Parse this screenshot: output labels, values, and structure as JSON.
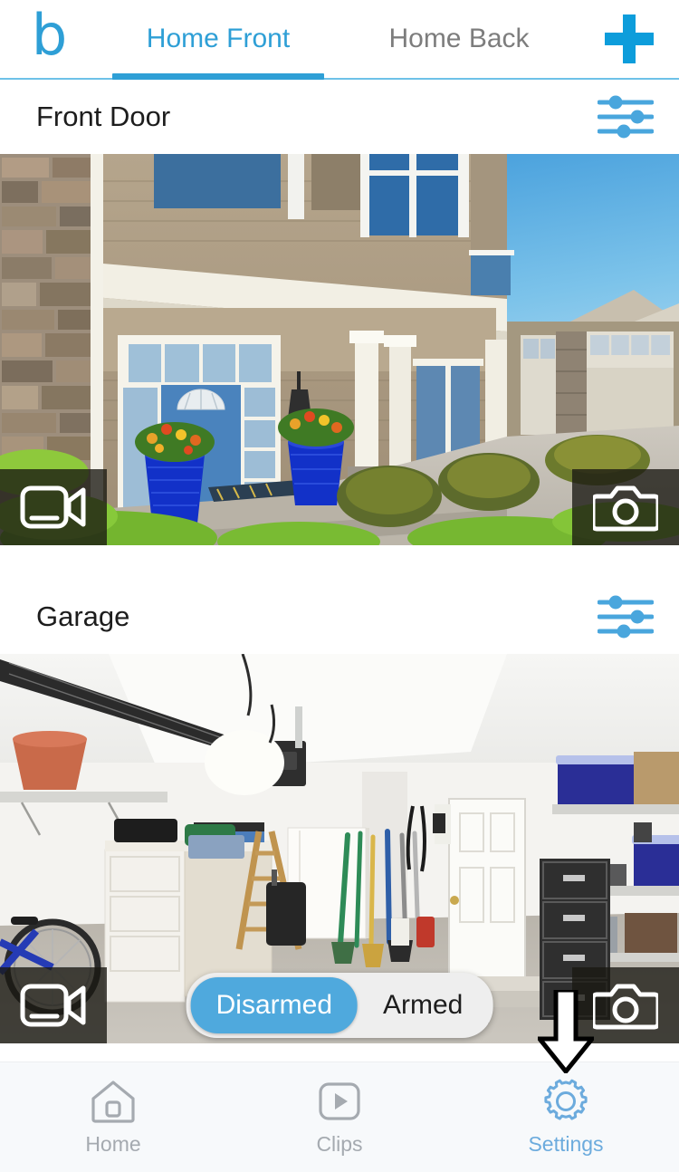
{
  "app": {
    "logo_text": "b",
    "logo_color": "#2e9fd6",
    "accent_color": "#2e9fd6",
    "add_button_label": "+"
  },
  "topbar": {
    "tabs": [
      {
        "label": "Home Front",
        "active": true
      },
      {
        "label": "Home Back",
        "active": false
      }
    ]
  },
  "cameras": [
    {
      "name": "Front Door",
      "settings_icon": "sliders-icon",
      "video_button_icon": "video-camera-icon",
      "photo_button_icon": "photo-camera-icon",
      "scene": "house-front-exterior-with-blue-door"
    },
    {
      "name": "Garage",
      "settings_icon": "sliders-icon",
      "video_button_icon": "video-camera-icon",
      "photo_button_icon": "photo-camera-icon",
      "scene": "garage-interior"
    }
  ],
  "arm_control": {
    "options": [
      {
        "label": "Disarmed",
        "selected": true
      },
      {
        "label": "Armed",
        "selected": false
      }
    ],
    "selected_color": "#4fa9dd",
    "track_color": "#eeeeee"
  },
  "tabbar": {
    "items": [
      {
        "label": "Home",
        "icon": "house-icon",
        "active": false
      },
      {
        "label": "Clips",
        "icon": "play-square-icon",
        "active": false
      },
      {
        "label": "Settings",
        "icon": "gear-icon",
        "active": true
      }
    ],
    "active_color": "#6cabdd",
    "inactive_color": "#a5aab0"
  },
  "annotation": {
    "arrow": "down-arrow-pointing-to-settings-tab",
    "fill": "#ffffff",
    "stroke": "#000000"
  }
}
